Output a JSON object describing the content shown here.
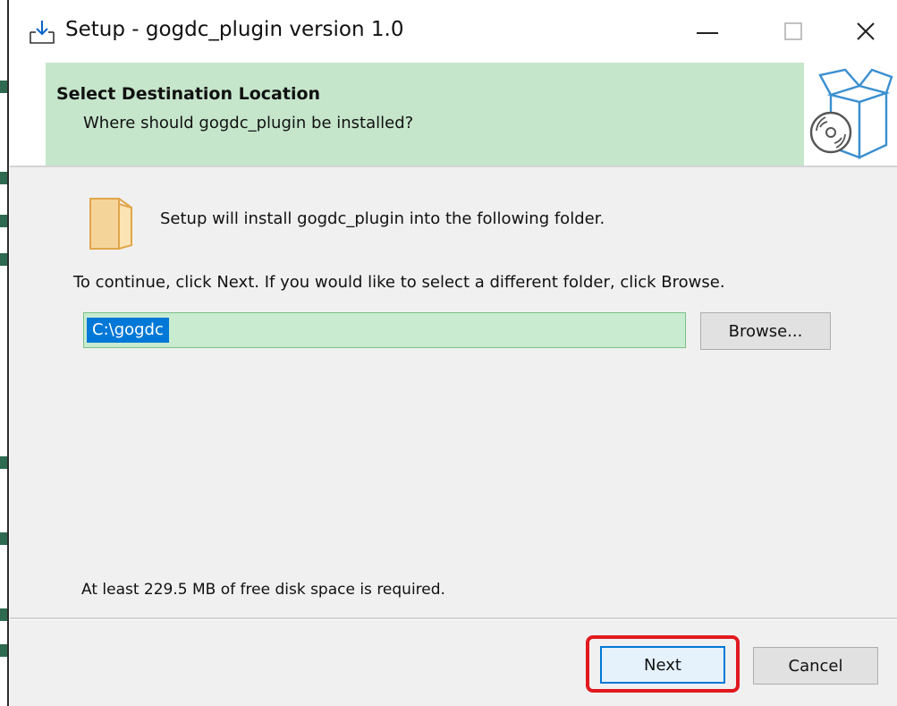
{
  "window": {
    "title": "Setup - gogdc_plugin version 1.0",
    "minimize_glyph": "—",
    "maximize_glyph": "☐",
    "close_glyph": "✕"
  },
  "header": {
    "title": "Select Destination Location",
    "subtitle": "Where should gogdc_plugin be installed?"
  },
  "body": {
    "install_message": "Setup will install gogdc_plugin into the following folder.",
    "continue_message": "To continue, click Next. If you would like to select a different folder, click Browse.",
    "path_value": "C:\\gogdc",
    "browse_label": "Browse...",
    "disk_space_message": "At least 229.5 MB of free disk space is required."
  },
  "footer": {
    "next_label": "Next",
    "cancel_label": "Cancel"
  },
  "icons": {
    "app": "download-icon",
    "folder": "folder-icon",
    "header_image": "software-box-disc-icon"
  },
  "colors": {
    "header_green": "#c6e6cc",
    "input_green": "#c9ecd0",
    "selection_blue": "#0078d7",
    "highlight_red": "#e1191f"
  }
}
